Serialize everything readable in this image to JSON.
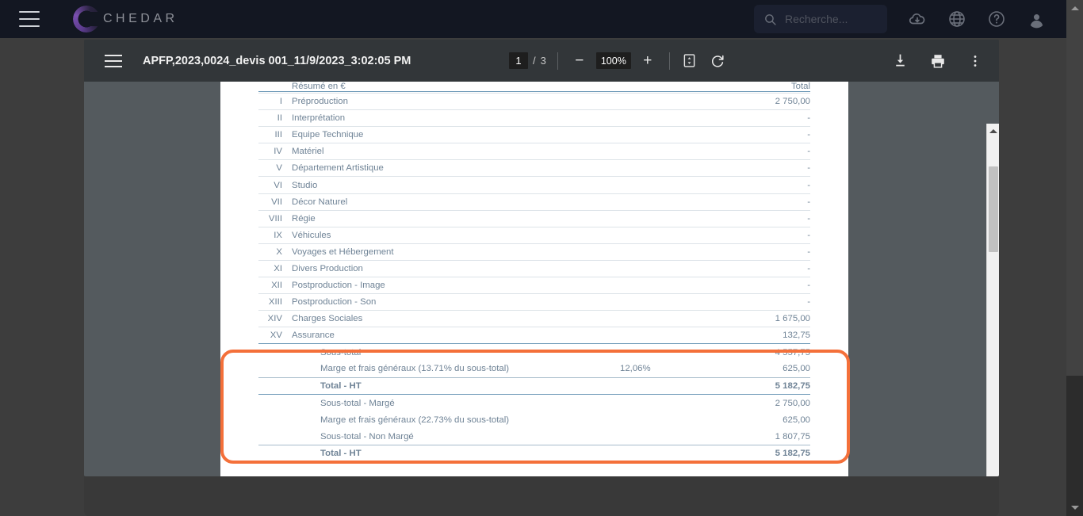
{
  "appbar": {
    "menu_icon": "hamburger-icon",
    "brand": "CHEDAR",
    "search": {
      "placeholder": "Recherche...",
      "value": "",
      "icon": "search-icon"
    },
    "icons": [
      {
        "name": "cloud-download-icon"
      },
      {
        "name": "globe-icon"
      },
      {
        "name": "help-icon"
      },
      {
        "name": "account-icon"
      }
    ]
  },
  "pdf_viewer": {
    "menu_icon": "sidebar-toggle-icon",
    "title": "APFP,2023,0024_devis 001_11/9/2023_3:02:05 PM",
    "page_current": "1",
    "page_separator": "/",
    "page_total": "3",
    "zoom_out_label": "−",
    "zoom_level": "100%",
    "zoom_in_label": "+",
    "fit_icon": "fit-page-icon",
    "rotate_icon": "rotate-icon",
    "download_icon": "download-icon",
    "print_icon": "print-icon",
    "more_icon": "more-options-icon"
  },
  "document": {
    "header": {
      "label": "Résumé en €",
      "total": "Total"
    },
    "rows": [
      {
        "num": "I",
        "label": "Préproduction",
        "value": "2 750,00"
      },
      {
        "num": "II",
        "label": "Interprétation",
        "value": "-"
      },
      {
        "num": "III",
        "label": "Equipe Technique",
        "value": "-"
      },
      {
        "num": "IV",
        "label": "Matériel",
        "value": "-"
      },
      {
        "num": "V",
        "label": "Département Artistique",
        "value": "-"
      },
      {
        "num": "VI",
        "label": "Studio",
        "value": "-"
      },
      {
        "num": "VII",
        "label": "Décor Naturel",
        "value": "-"
      },
      {
        "num": "VIII",
        "label": "Régie",
        "value": "-"
      },
      {
        "num": "IX",
        "label": "Véhicules",
        "value": "-"
      },
      {
        "num": "X",
        "label": "Voyages et Hébergement",
        "value": "-"
      },
      {
        "num": "XI",
        "label": "Divers Production",
        "value": "-"
      },
      {
        "num": "XII",
        "label": "Postproduction - Image",
        "value": "-"
      },
      {
        "num": "XIII",
        "label": "Postproduction - Son",
        "value": "-"
      },
      {
        "num": "XIV",
        "label": "Charges Sociales",
        "value": "1 675,00"
      },
      {
        "num": "XV",
        "label": "Assurance",
        "value": "132,75"
      }
    ],
    "summary_block_1": [
      {
        "label": "Sous-total",
        "mid": "",
        "value": "4 557,75"
      },
      {
        "label": "Marge et frais généraux (13.71% du sous-total)",
        "mid": "12,06%",
        "value": "625,00"
      },
      {
        "label": "Total - HT",
        "mid": "",
        "value": "5 182,75"
      }
    ],
    "summary_block_2": [
      {
        "label": "Sous-total - Margé",
        "mid": "",
        "value": "2 750,00"
      },
      {
        "label": "Marge et frais généraux (22.73% du sous-total)",
        "mid": "",
        "value": "625,00"
      },
      {
        "label": "Sous-total - Non Margé",
        "mid": "",
        "value": "1 807,75"
      },
      {
        "label": "Total - HT",
        "mid": "",
        "value": "5 182,75"
      }
    ]
  },
  "colors": {
    "appbar_bg": "#131722",
    "viewer_chrome": "#323639",
    "doc_bg": "#545a5e",
    "highlight": "#f4703a",
    "table_text": "#6f8396",
    "table_header": "#4a7fae",
    "total_text": "#2d6ca2"
  }
}
